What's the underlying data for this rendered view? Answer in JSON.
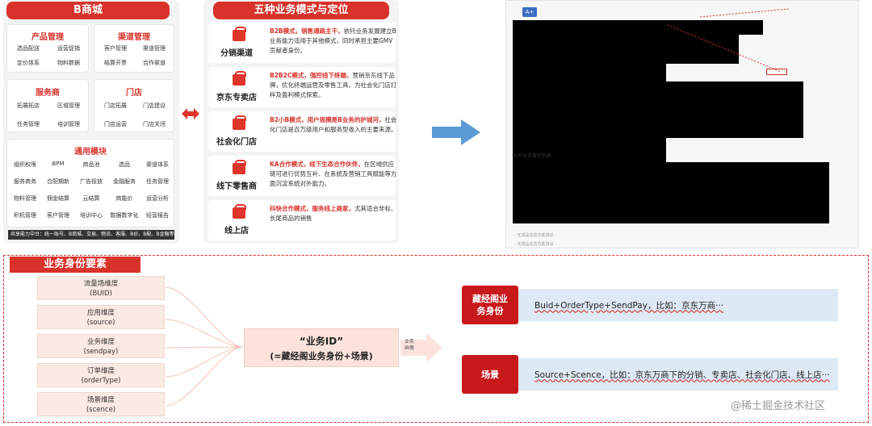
{
  "bmall": {
    "title": "B商城",
    "product": {
      "title": "产品管理",
      "items": [
        "选品配送",
        "运营促销",
        "定价体系",
        "物料数据"
      ]
    },
    "channel": {
      "title": "渠道管理",
      "items": [
        "客户管理",
        "渠道管理",
        "结算开票",
        "合作渠道"
      ]
    },
    "service": {
      "title": "服务商",
      "items": [
        "拓展拓店",
        "区域管理",
        "任务管理",
        "培训管理"
      ]
    },
    "store": {
      "title": "门店",
      "items": [
        "门店拓展",
        "门店建设",
        "门店运营",
        "门店关闭"
      ]
    },
    "common": {
      "title": "通用模块",
      "items": [
        "组织权限",
        "BPM",
        "商品池",
        "选品",
        "渠道体系",
        "服务商务",
        "合配期新",
        "广告投放",
        "金融服务",
        "任务管理",
        "物料管理",
        "佣金结算",
        "云结算",
        "商能价",
        "运营分析",
        "积机管理",
        "客户管理",
        "培训中心",
        "数据数字化",
        "经营报告"
      ]
    },
    "footer": "共享能力中台：统一账号、B商城、交易、物流、客服、B价、B配、B金融等"
  },
  "modes": {
    "title": "五种业务模式与定位",
    "items": [
      {
        "name": "分销渠道",
        "highlight": "B2B模式，销售通路主干，",
        "text": "依托业务发展建立B业务能力适用于其他模式，同时承担主要GMV贡献者身份。"
      },
      {
        "name": "京东专卖店",
        "highlight": "B2B2C模式，强控线下终端，",
        "text": "营销京东线下品牌，优化终端运营及零售工具，为社会化门店打样及盈利模式探索。"
      },
      {
        "name": "社会化门店",
        "highlight": "B2小B模式，用户规模是B业务的护城河，",
        "text": "社会化门店是百万级用户和服务型收入的主要来源。"
      },
      {
        "name": "线下零售商",
        "highlight": "KA合作模式，线下生态合作伙伴，",
        "text": "在区域供应链可进行优势互补、在系统及营销工具赋能等方面沉淀系统对外能力。"
      },
      {
        "name": "线上店",
        "highlight": "抖快合作模式，服务线上商家，",
        "text": "尤其适合非标、长尾商品的销售"
      }
    ],
    "overlay": "定义"
  },
  "screenshot": {
    "btn": "A+",
    "tab": "水平业务身份列表",
    "row1": "- 无货品信息方案测试 -",
    "row2": "- 无货品信息方案测试 -"
  },
  "identity": {
    "title": "业务身份要素",
    "dims": [
      {
        "label": "流量场维度",
        "sub": "(BUID)"
      },
      {
        "label": "应用维度",
        "sub": "(source)"
      },
      {
        "label": "业务维度",
        "sub": "(sendpay)"
      },
      {
        "label": "订单维度",
        "sub": "(orderType)"
      },
      {
        "label": "场景维度",
        "sub": "(scence)"
      }
    ],
    "center_line1": "“业务ID”",
    "center_line2": "(=藏经阁业务身份+场景)",
    "arrow_label": "业务\n画像",
    "right": [
      {
        "label": "藏经阁业务身份",
        "desc": "Buid+OrderType+SendPay，比如：京东万商···"
      },
      {
        "label": "场景",
        "desc": "Source+Scence，比如：京东万商下的分销、专卖店、社会化门店、线上店···"
      }
    ]
  },
  "watermark": "@稀土掘金技术社区",
  "colors": {
    "accent": "#d9322b",
    "darkred": "#c8191d",
    "blue": "#dde9f4",
    "pink": "#fbe9e3"
  }
}
